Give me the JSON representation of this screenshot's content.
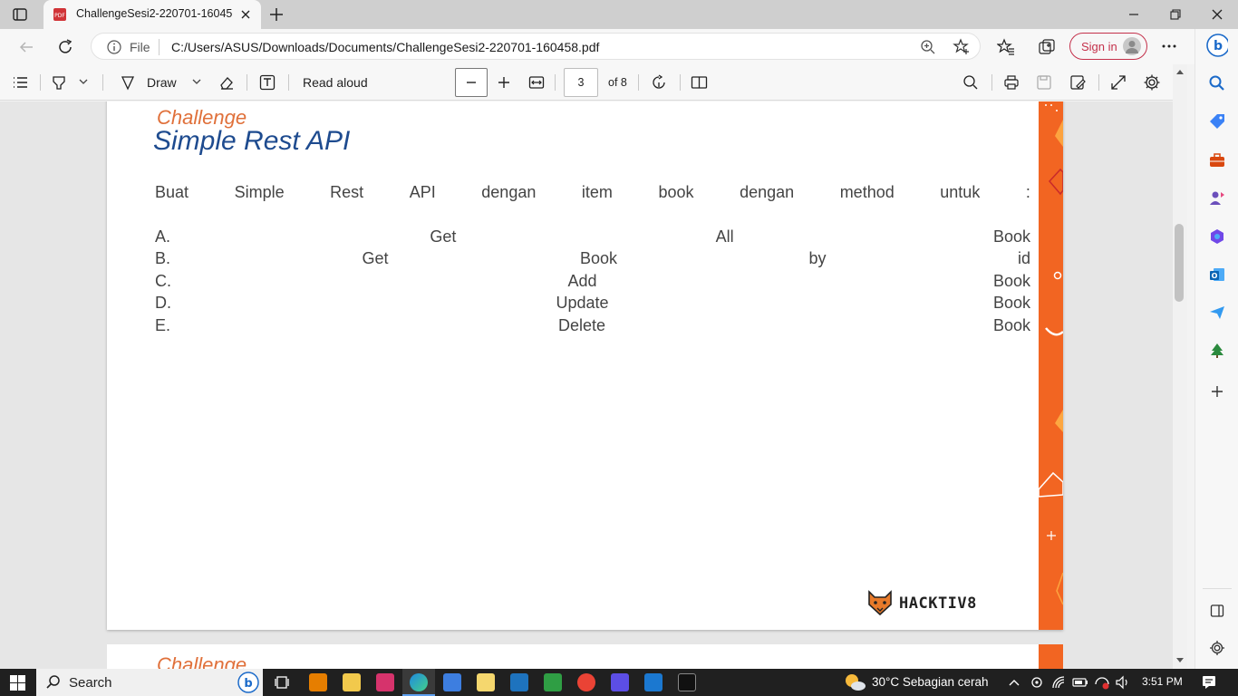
{
  "browser": {
    "tab_title": "ChallengeSesi2-220701-160458.pdf",
    "file_label": "File",
    "url": "C:/Users/ASUS/Downloads/Documents/ChallengeSesi2-220701-160458.pdf",
    "signin_label": "Sign in"
  },
  "pdf_toolbar": {
    "draw_label": "Draw",
    "read_aloud_label": "Read aloud",
    "page_number": "3",
    "page_total": "of 8"
  },
  "document": {
    "eyebrow": "Challenge",
    "title": "Simple Rest API",
    "intro_words": [
      "Buat",
      "Simple",
      "Rest",
      "API",
      "dengan",
      "item",
      "book",
      "dengan",
      "method",
      "untuk",
      ":"
    ],
    "items": [
      {
        "marker": "A.",
        "words": [
          "Get",
          "All",
          "Book"
        ]
      },
      {
        "marker": "B.",
        "words": [
          "Get",
          "Book",
          "by",
          "id"
        ]
      },
      {
        "marker": "C.",
        "words": [
          "Add",
          "Book"
        ]
      },
      {
        "marker": "D.",
        "words": [
          "Update",
          "Book"
        ]
      },
      {
        "marker": "E.",
        "words": [
          "Delete",
          "Book"
        ]
      }
    ],
    "logo_text": "HACKTIV8",
    "next_page_eyebrow": "Challenge"
  },
  "taskbar": {
    "search_label": "Search",
    "weather": "30°C  Sebagian cerah",
    "clock": "3:51 PM"
  },
  "colors": {
    "accent_orange": "#f26522",
    "title_blue": "#1e4b8f",
    "eyebrow_orange": "#e0703a",
    "signin_red": "#c4314b"
  }
}
